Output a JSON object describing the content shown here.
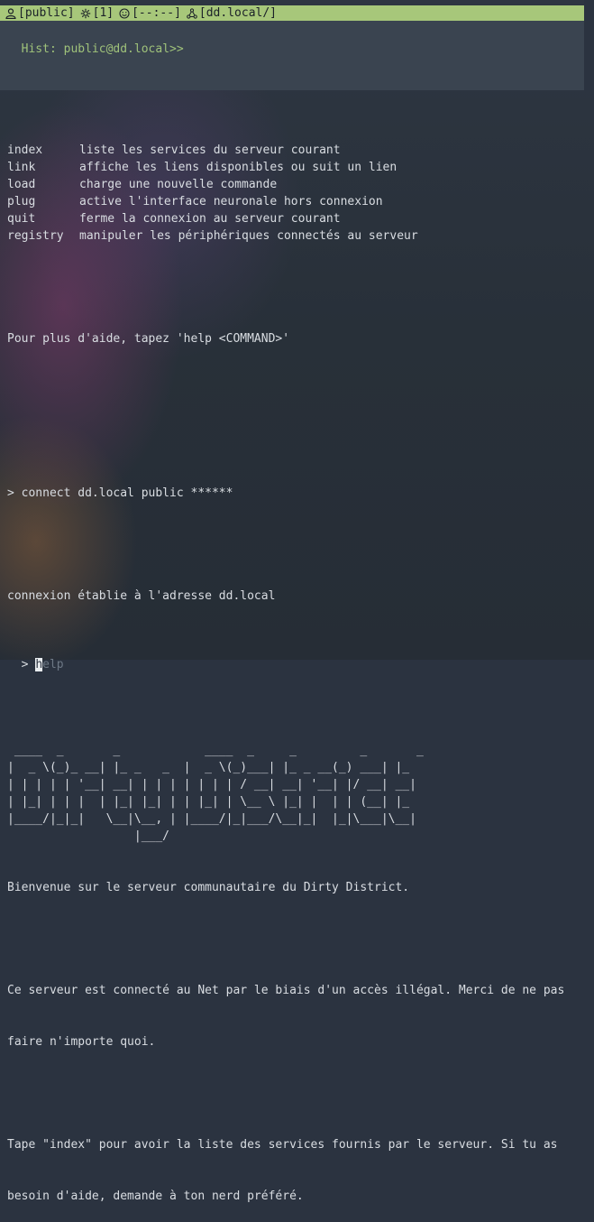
{
  "status_bar": {
    "user": "[public]",
    "gear": "[1]",
    "face": "[--:--]",
    "host": "[dd.local/]"
  },
  "history": {
    "text": "Hist: public@dd.local>>"
  },
  "help": {
    "commands": [
      {
        "name": "index",
        "desc": "liste les services du serveur courant"
      },
      {
        "name": "link",
        "desc": "affiche les liens disponibles ou suit un lien"
      },
      {
        "name": "load",
        "desc": "charge une nouvelle commande"
      },
      {
        "name": "plug",
        "desc": "active l'interface neuronale hors connexion"
      },
      {
        "name": "quit",
        "desc": "ferme la connexion au serveur courant"
      },
      {
        "name": "registry",
        "desc": "manipuler les périphériques connectés au serveur"
      }
    ],
    "more": "Pour plus d'aide, tapez 'help <COMMAND>'"
  },
  "session": {
    "connect_cmd": "> connect dd.local public ******",
    "connected_msg": "connexion établie à l'adresse dd.local"
  },
  "banner": {
    "ascii": " ____  _       _            ____  _     _         _       _\n|  _ \\(_)_ __| |_ _   _  |  _ \\(_)___| |_ _ __(_) ___| |_\n| | | | | '__| __| | | | | | | | / __| __| '__| |/ __| __|\n| |_| | | |  | |_| |_| | | |_| | \\__ \\ |_| |  | | (__| |_\n|____/|_|_|   \\__|\\__, | |____/|_|___/\\__|_|  |_|\\___|\\__|\n                  |___/",
    "welcome": "Bienvenue sur le serveur communautaire du Dirty District.",
    "notice_1": "Ce serveur est connecté au Net par le biais d'un accès illégal. Merci de ne pas",
    "notice_2": "faire n'importe quoi.",
    "tip_1": "Tape \"index\" pour avoir la liste des services fournis par le serveur. Si tu as",
    "tip_2": "besoin d'aide, demande à ton nerd préféré."
  },
  "input": {
    "prompt": ">",
    "cursor_char": "h",
    "placeholder_rest": "elp"
  },
  "colors": {
    "status_bar_bg": "#a7c77a",
    "history_bg": "#3a4450",
    "history_text": "#9fc27a",
    "text": "#d9dde2"
  }
}
